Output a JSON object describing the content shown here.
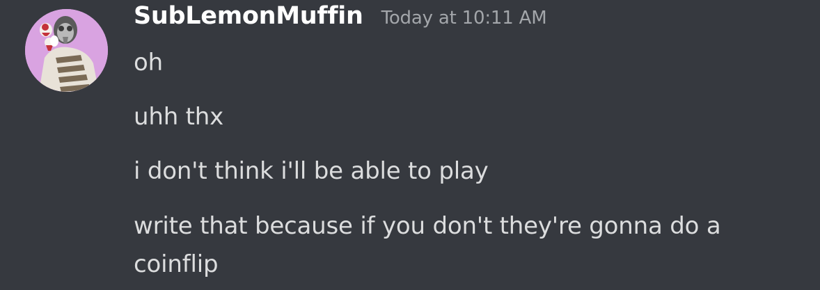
{
  "author": {
    "username": "SubLemonMuffin",
    "timestamp": "Today at 10:11 AM",
    "avatar_icon": "user-avatar-icon",
    "avatar_bg": "#d9a3e1",
    "username_color": "#ffffff"
  },
  "messages": [
    {
      "text": "oh"
    },
    {
      "text": "uhh thx"
    },
    {
      "text": "i don't think i'll be able to play"
    },
    {
      "text": "write that because if you don't they're gonna do a coinflip"
    }
  ],
  "colors": {
    "background": "#36393f",
    "message_text": "#dcddde",
    "timestamp": "#a3a6aa"
  }
}
